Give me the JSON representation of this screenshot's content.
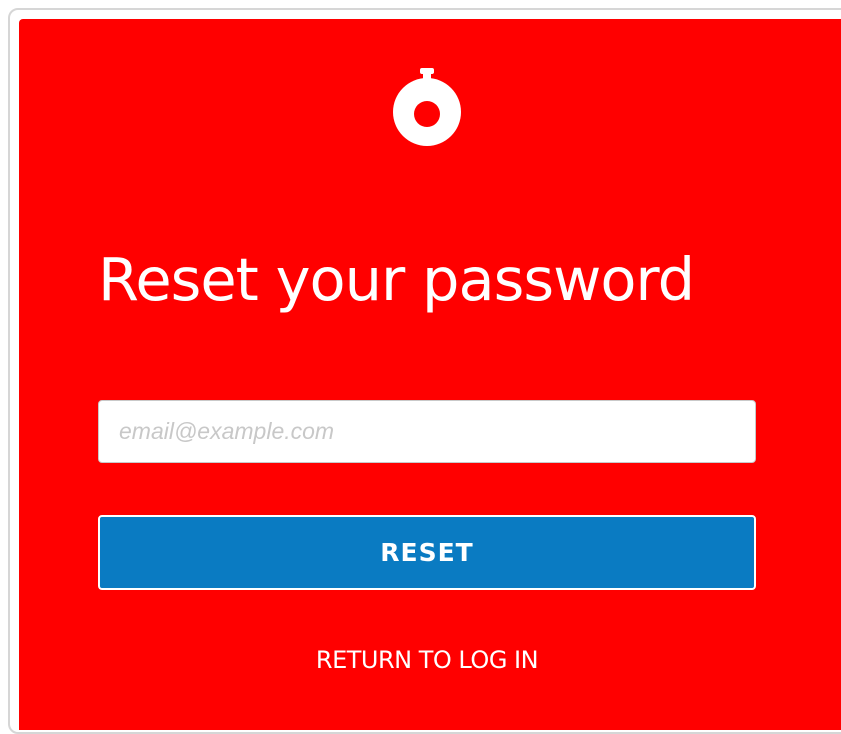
{
  "logo": {
    "icon": "stopwatch-icon",
    "color": "#ffffff"
  },
  "page": {
    "title": "Reset your password"
  },
  "form": {
    "email_placeholder": "email@example.com",
    "email_value": "",
    "reset_label": "RESET",
    "return_link_label": "RETURN TO LOG IN"
  },
  "colors": {
    "background": "#ff0000",
    "button": "#0a7bc2",
    "text": "#ffffff"
  }
}
